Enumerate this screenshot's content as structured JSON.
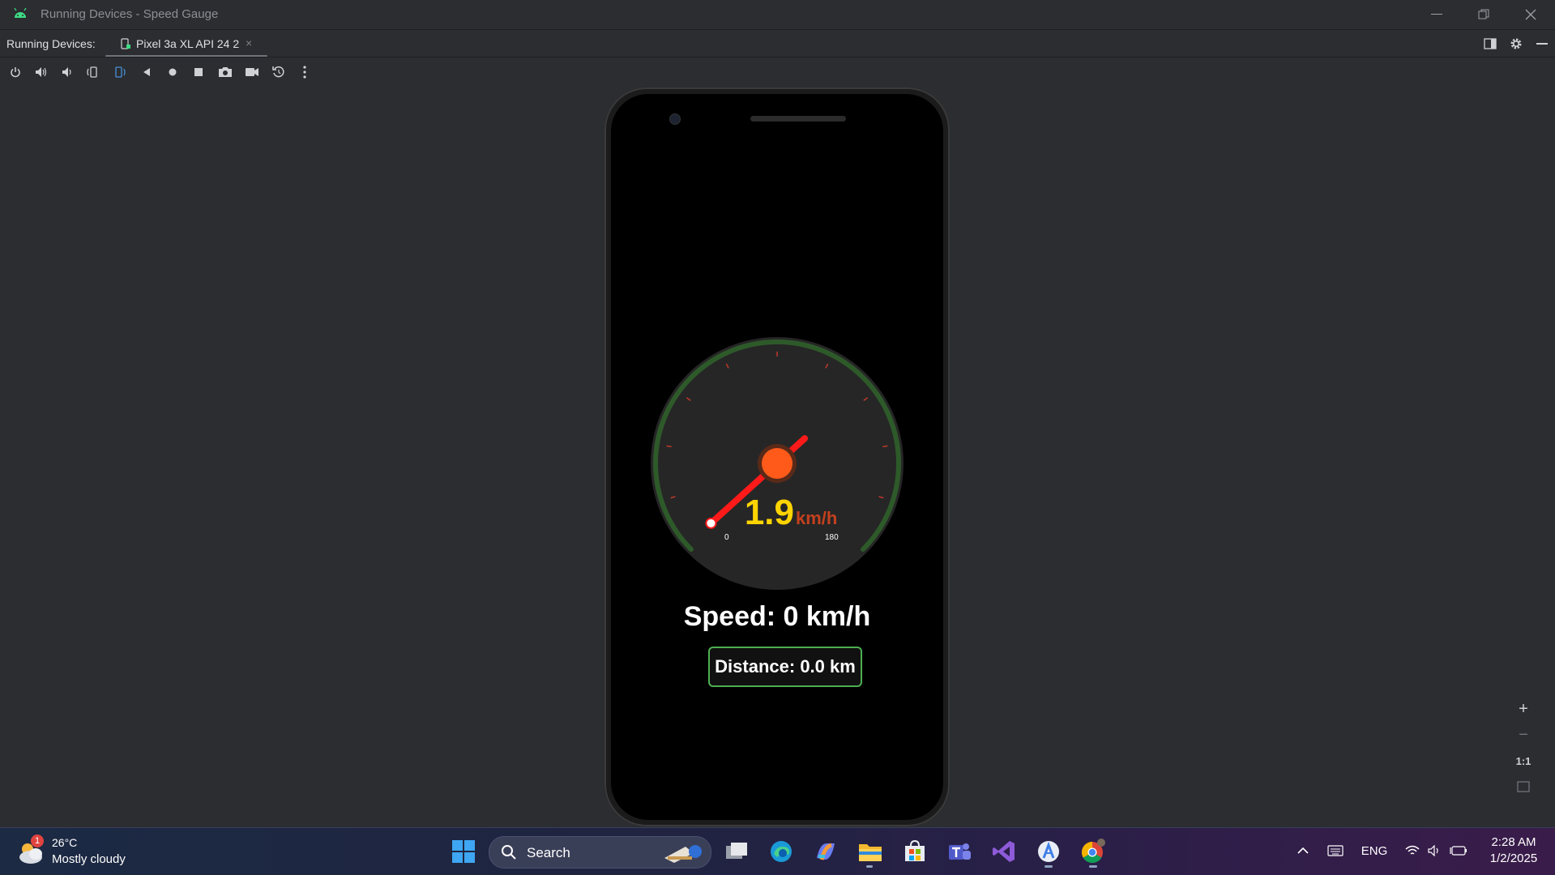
{
  "window": {
    "title": "Running Devices - Speed Gauge"
  },
  "tabs_row": {
    "label": "Running Devices:",
    "tab": {
      "label": "Pixel 3a XL API 24 2",
      "close": "×"
    }
  },
  "toolbar": {
    "tools": [
      "power-icon",
      "volume-up-icon",
      "volume-down-icon",
      "rotate-left-icon",
      "rotate-right-icon",
      "back-icon",
      "home-icon",
      "overview-icon",
      "screenshot-icon",
      "screen-record-icon",
      "reset-icon",
      "more-icon"
    ]
  },
  "zoom": {
    "zoom_in": "+",
    "zoom_out": "−",
    "actual_size": "1:1"
  },
  "app": {
    "gauge": {
      "value": "1.9",
      "unit": "km/h",
      "min_label": "0",
      "max_label": "180",
      "min": 0,
      "max": 180,
      "needle_value": 1.9,
      "arc_color": "#2e5a2a",
      "needle_color": "#ff1a1a",
      "value_color": "#ffd400",
      "unit_color": "#c4411d",
      "hub_color": "#ff5a1a"
    },
    "speed_text": "Speed: 0 km/h",
    "distance_text": "Distance: 0.0 km",
    "distance_border_color": "#4caf50"
  },
  "taskbar": {
    "weather": {
      "badge": "1",
      "temp": "26°C",
      "condition": "Mostly cloudy"
    },
    "search_label": "Search",
    "apps": [
      "windows-start-icon",
      "task-view-icon",
      "edge-icon",
      "copilot-icon",
      "file-explorer-icon",
      "store-icon",
      "teams-icon",
      "visual-studio-icon",
      "android-studio-icon",
      "chrome-icon"
    ],
    "tray": {
      "language": "ENG"
    },
    "clock": {
      "time": "2:28 AM",
      "date": "1/2/2025"
    }
  }
}
